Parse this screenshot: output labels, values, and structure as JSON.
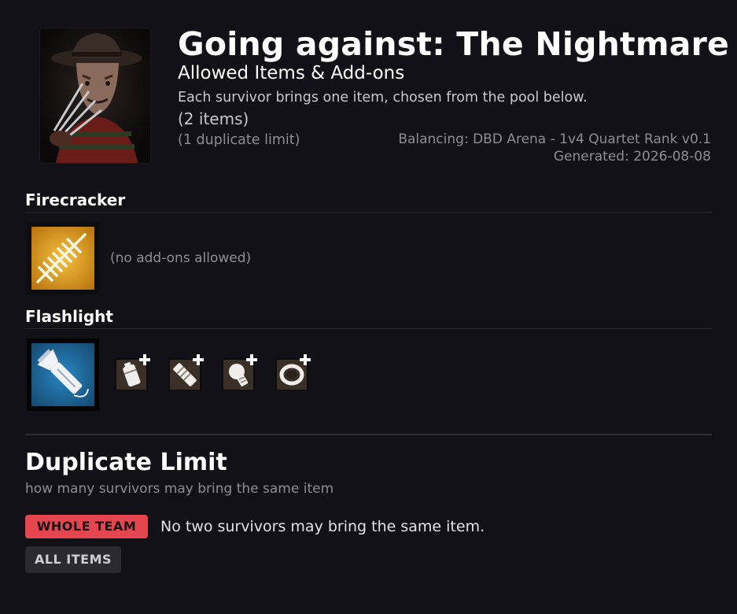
{
  "header": {
    "title": "Going against: The Nightmare",
    "subtitle": "Allowed Items & Add-ons",
    "description": "Each survivor brings one item, chosen from the pool below.",
    "item_count": "(2 items)",
    "duplicate_note": "(1 duplicate limit)",
    "balancing": "Balancing: DBD Arena - 1v4 Quartet Rank v0.1",
    "generated": "Generated: 2026-08-08"
  },
  "items": [
    {
      "name": "Firecracker",
      "icon": "firecracker-icon",
      "rarity_color": "#d99a1f",
      "addons_note": "(no add-ons allowed)"
    },
    {
      "name": "Flashlight",
      "icon": "flashlight-icon",
      "rarity_color": "#1e6aa1",
      "addons": [
        "battery-addon-icon",
        "lens-addon-icon",
        "bulb-addon-icon",
        "ring-addon-icon"
      ]
    }
  ],
  "duplicate_limit": {
    "heading": "Duplicate Limit",
    "hint": "how many survivors may bring the same item",
    "whole_team_label": "WHOLE TEAM",
    "whole_team_color": "#e5454e",
    "whole_team_rule": "No two survivors may bring the same item.",
    "all_items_label": "ALL ITEMS"
  }
}
